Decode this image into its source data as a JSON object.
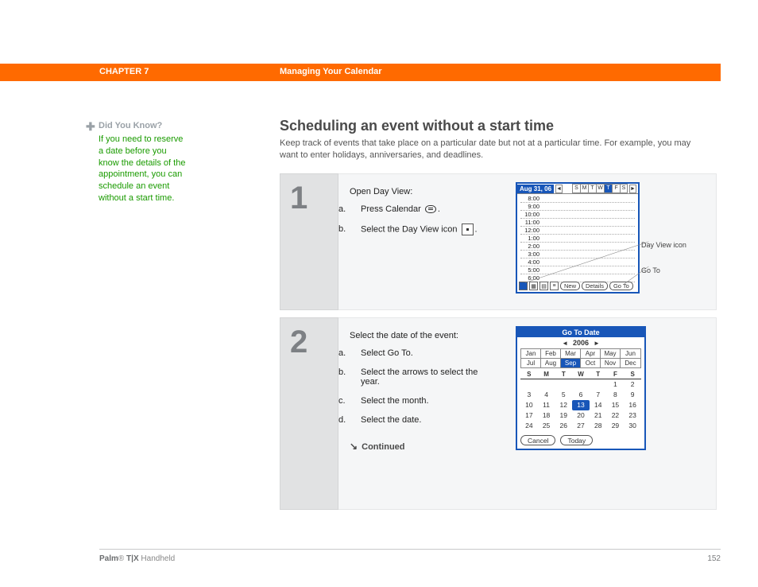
{
  "header": {
    "chapter": "CHAPTER 7",
    "title": "Managing Your Calendar"
  },
  "tip": {
    "label": "Did You Know?",
    "body": "If you need to reserve a date before you know the details of the appointment, you can schedule an event without a start time."
  },
  "heading": "Scheduling an event without a start time",
  "intro": "Keep track of events that take place on a particular date but not at a particular time. For example, you may want to enter holidays, anniversaries, and deadlines.",
  "step1": {
    "number": "1",
    "lead": "Open Day View:",
    "a": "Press Calendar",
    "a_tail": ".",
    "b": "Select the Day View icon",
    "b_tail": "."
  },
  "dayview": {
    "date": "Aug 31, 06",
    "days": [
      "S",
      "M",
      "T",
      "W",
      "T",
      "F",
      "S"
    ],
    "selected_day_index": 4,
    "hours": [
      "8:00",
      "9:00",
      "10:00",
      "11:00",
      "12:00",
      "1:00",
      "2:00",
      "3:00",
      "4:00",
      "5:00",
      "6:00"
    ],
    "buttons": {
      "new": "New",
      "details": "Details",
      "goto": "Go To"
    },
    "callouts": {
      "dayview": "Day View icon",
      "goto": "Go To"
    }
  },
  "step2": {
    "number": "2",
    "lead": "Select the date of the event:",
    "a": "Select Go To.",
    "b": "Select the arrows to select the year.",
    "c": "Select the month.",
    "d": "Select the date.",
    "continued": "Continued"
  },
  "gotodate": {
    "title": "Go To Date",
    "year": "2006",
    "months": [
      "Jan",
      "Feb",
      "Mar",
      "Apr",
      "May",
      "Jun",
      "Jul",
      "Aug",
      "Sep",
      "Oct",
      "Nov",
      "Dec"
    ],
    "selected_month_index": 8,
    "weekdays": [
      "S",
      "M",
      "T",
      "W",
      "T",
      "F",
      "S"
    ],
    "grid": [
      [
        "",
        "",
        "",
        "",
        "",
        "1",
        "2"
      ],
      [
        "3",
        "4",
        "5",
        "6",
        "7",
        "8",
        "9"
      ],
      [
        "10",
        "11",
        "12",
        "13",
        "14",
        "15",
        "16"
      ],
      [
        "17",
        "18",
        "19",
        "20",
        "21",
        "22",
        "23"
      ],
      [
        "24",
        "25",
        "26",
        "27",
        "28",
        "29",
        "30"
      ]
    ],
    "selected_date": "13",
    "buttons": {
      "cancel": "Cancel",
      "today": "Today"
    }
  },
  "footer": {
    "brand_strong": "Palm",
    "brand_reg": "®",
    "brand_model": " T|X",
    "brand_tail": " Handheld",
    "page": "152"
  }
}
